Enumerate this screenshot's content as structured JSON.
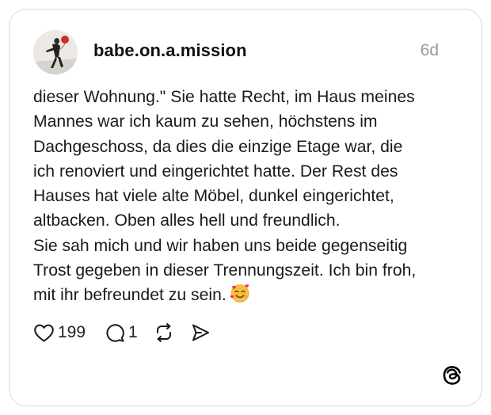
{
  "post": {
    "username": "babe.on.a.mission",
    "timestamp": "6d",
    "text": "dieser Wohnung.\" Sie hatte Recht, im Haus meines\nMannes war ich kaum zu sehen, höchstens im\nDachgeschoss, da dies die einzige Etage war, die\nich renoviert und eingerichtet hatte. Der Rest des\nHauses hat viele alte Möbel, dunkel eingerichtet,\naltbacken. Oben alles hell und freundlich.\nSie sah mich und wir haben uns beide gegenseitig\nTrost gegeben in dieser Trennungszeit. Ich bin froh,\nmit ihr befreundet zu sein.",
    "emoji": "smiling-face-with-hearts"
  },
  "actions": {
    "likes": "199",
    "replies": "1",
    "like_icon": "heart-icon",
    "reply_icon": "comment-bubble-icon",
    "repost_icon": "repost-icon",
    "share_icon": "send-icon"
  },
  "branding": {
    "logo": "threads-logo-icon"
  },
  "colors": {
    "text": "#1a1a1a",
    "muted": "#9a9a9a",
    "border": "#d9d9d9",
    "background": "#ffffff"
  }
}
